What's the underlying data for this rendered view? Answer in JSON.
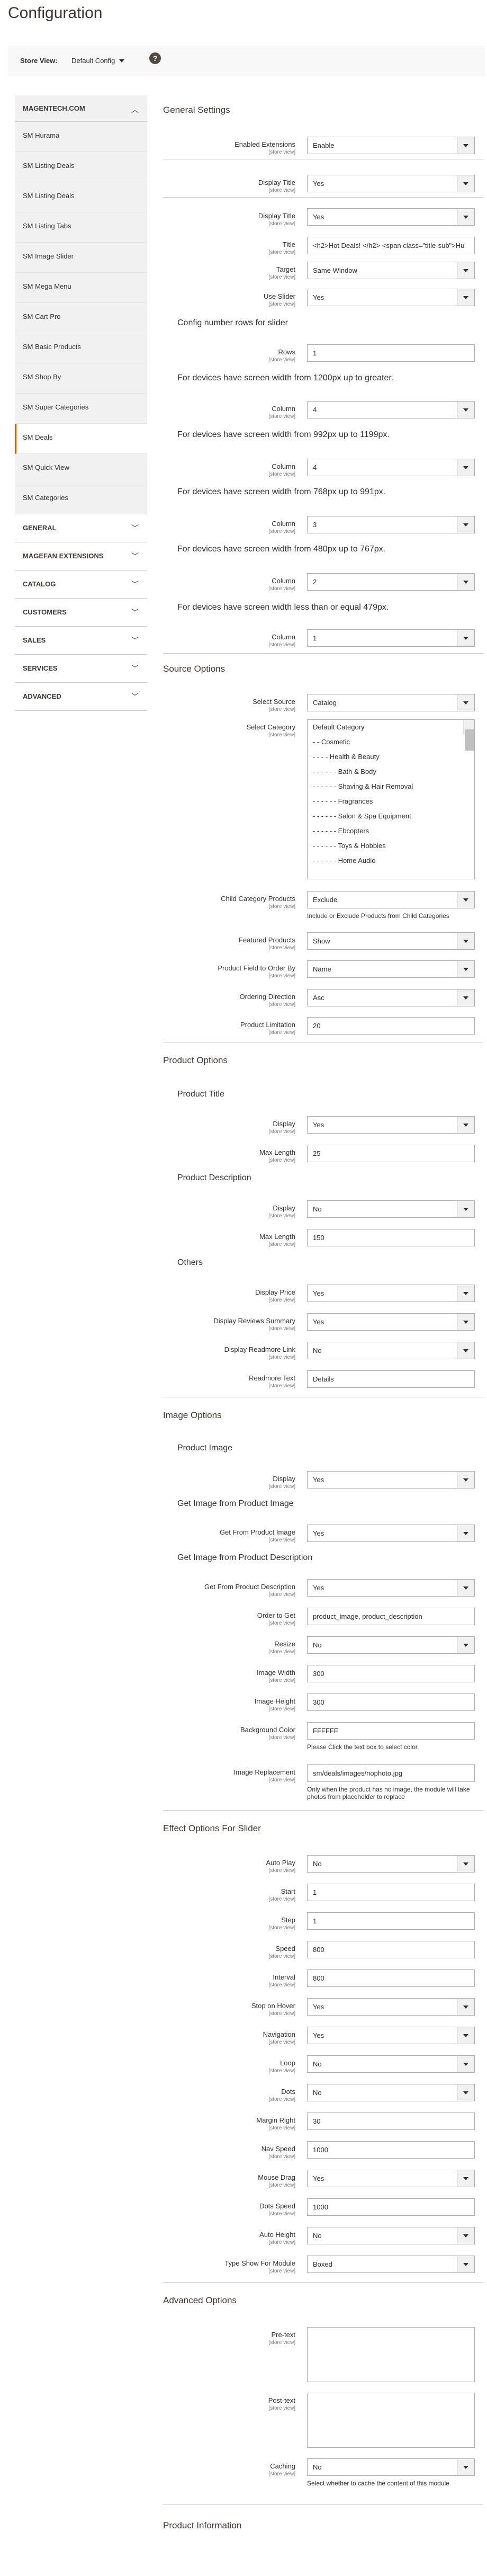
{
  "page": {
    "title": "Configuration"
  },
  "scope": {
    "label": "Store View:",
    "value": "Default Config"
  },
  "sidebar": {
    "head": "MAGENTECH.COM",
    "items": [
      "SM Hurama",
      "SM Listing Deals",
      "SM Listing Deals",
      "SM Listing Tabs",
      "SM Image Slider",
      "SM Mega Menu",
      "SM Cart Pro",
      "SM Basic Products",
      "SM Shop By",
      "SM Super Categories",
      "SM Deals",
      "SM Quick View",
      "SM Categories"
    ],
    "active_item": "SM Deals",
    "sections": [
      "GENERAL",
      "MAGEFAN EXTENSIONS",
      "CATALOG",
      "CUSTOMERS",
      "SALES",
      "SERVICES",
      "ADVANCED"
    ]
  },
  "scope_hint": "[store view]",
  "groups": {
    "general": "General Settings",
    "config_number": "Config number rows for slider",
    "dev1200": "For devices have screen width from 1200px up to greater.",
    "dev992": "For devices have screen width from 992px up to 1199px.",
    "dev768": "For devices have screen width from 768px up to 991px.",
    "dev480": "For devices have screen width from 480px up to 767px.",
    "dev479": "For devices have screen width less than or equal 479px.",
    "source": "Source Options",
    "product": "Product Options",
    "product_title": "Product Title",
    "product_desc": "Product Description",
    "others": "Others",
    "image": "Image Options",
    "product_image": "Product Image",
    "get_from_image": "Get Image from Product Image",
    "get_from_desc": "Get Image from Product Description",
    "effect": "Effect Options For Slider",
    "advanced": "Advanced Options",
    "product_info": "Product Information"
  },
  "fields": {
    "enabled": {
      "label": "Enabled Extensions",
      "value": "Enable"
    },
    "display_title1": {
      "label": "Display Title",
      "value": "Yes"
    },
    "display_title2": {
      "label": "Display Title",
      "value": "Yes"
    },
    "title": {
      "label": "Title",
      "value": "<h2>Hot Deals! </h2> <span class=\"title-sub\">Hu"
    },
    "target": {
      "label": "Target",
      "value": "Same Window"
    },
    "use_slider": {
      "label": "Use Slider",
      "value": "Yes"
    },
    "rows": {
      "label": "Rows",
      "value": "1"
    },
    "col1200": {
      "label": "Column",
      "value": "4"
    },
    "col992": {
      "label": "Column",
      "value": "4"
    },
    "col768": {
      "label": "Column",
      "value": "3"
    },
    "col480": {
      "label": "Column",
      "value": "2"
    },
    "col479": {
      "label": "Column",
      "value": "1"
    },
    "select_source": {
      "label": "Select Source",
      "value": "Catalog"
    },
    "select_category": {
      "label": "Select Category",
      "options": [
        "Default Category",
        "- - Cosmetic",
        "- - - - Health & Beauty",
        "- - - - - - Bath & Body",
        "- - - - - - Shaving & Hair Removal",
        "- - - - - - Fragrances",
        "- - - - - - Salon & Spa Equipment",
        "- - - - - - Ebcopters",
        "- - - - - - Toys & Hobbies",
        "- - - - - - Home Audio"
      ]
    },
    "child_category": {
      "label": "Child Category Products",
      "value": "Exclude",
      "note": "Include or Exclude Products from Child Categories"
    },
    "featured": {
      "label": "Featured Products",
      "value": "Show"
    },
    "order_by": {
      "label": "Product Field to Order By",
      "value": "Name"
    },
    "ordering_direction": {
      "label": "Ordering Direction",
      "value": "Asc"
    },
    "limitation": {
      "label": "Product Limitation",
      "value": "20"
    },
    "pt_display": {
      "label": "Display",
      "value": "Yes"
    },
    "pt_max": {
      "label": "Max Length",
      "value": "25"
    },
    "pd_display": {
      "label": "Display",
      "value": "No"
    },
    "pd_max": {
      "label": "Max Length",
      "value": "150"
    },
    "display_price": {
      "label": "Display Price",
      "value": "Yes"
    },
    "display_reviews": {
      "label": "Display Reviews Summary",
      "value": "Yes"
    },
    "display_readmore": {
      "label": "Display Readmore Link",
      "value": "No"
    },
    "readmore_text": {
      "label": "Readmore Text",
      "value": "Details"
    },
    "pi_display": {
      "label": "Display",
      "value": "Yes"
    },
    "get_product_image": {
      "label": "Get From Product Image",
      "value": "Yes"
    },
    "get_product_desc": {
      "label": "Get From Product Description",
      "value": "Yes"
    },
    "order_to_get": {
      "label": "Order to Get",
      "value": "product_image, product_description"
    },
    "resize": {
      "label": "Resize",
      "value": "No"
    },
    "image_width": {
      "label": "Image Width",
      "value": "300"
    },
    "image_height": {
      "label": "Image Height",
      "value": "300"
    },
    "background_color": {
      "label": "Background Color",
      "value": "FFFFFF",
      "note": "Please Click the text box to select color."
    },
    "image_replacement": {
      "label": "Image Replacement",
      "value": "sm/deals/images/nophoto.jpg",
      "note": "Only when the product has no image, the module will take photos from placeholder to replace"
    },
    "auto_play": {
      "label": "Auto Play",
      "value": "No"
    },
    "start": {
      "label": "Start",
      "value": "1"
    },
    "step": {
      "label": "Step",
      "value": "1"
    },
    "speed": {
      "label": "Speed",
      "value": "800"
    },
    "interval": {
      "label": "Interval",
      "value": "800"
    },
    "stop_hover": {
      "label": "Stop on Hover",
      "value": "Yes"
    },
    "navigation": {
      "label": "Navigation",
      "value": "Yes"
    },
    "loop": {
      "label": "Loop",
      "value": "No"
    },
    "dots": {
      "label": "Dots",
      "value": "No"
    },
    "margin_right": {
      "label": "Margin Right",
      "value": "30"
    },
    "nav_speed": {
      "label": "Nav Speed",
      "value": "1000"
    },
    "mouse_drag": {
      "label": "Mouse Drag",
      "value": "Yes"
    },
    "dots_speed": {
      "label": "Dots Speed",
      "value": "1000"
    },
    "auto_height": {
      "label": "Auto Height",
      "value": "No"
    },
    "type_show": {
      "label": "Type Show For Module",
      "value": "Boxed"
    },
    "pretext": {
      "label": "Pre-text",
      "value": ""
    },
    "posttext": {
      "label": "Post-text",
      "value": ""
    },
    "caching": {
      "label": "Caching",
      "value": "No",
      "note": "Select whether to cache the content of this module"
    }
  }
}
